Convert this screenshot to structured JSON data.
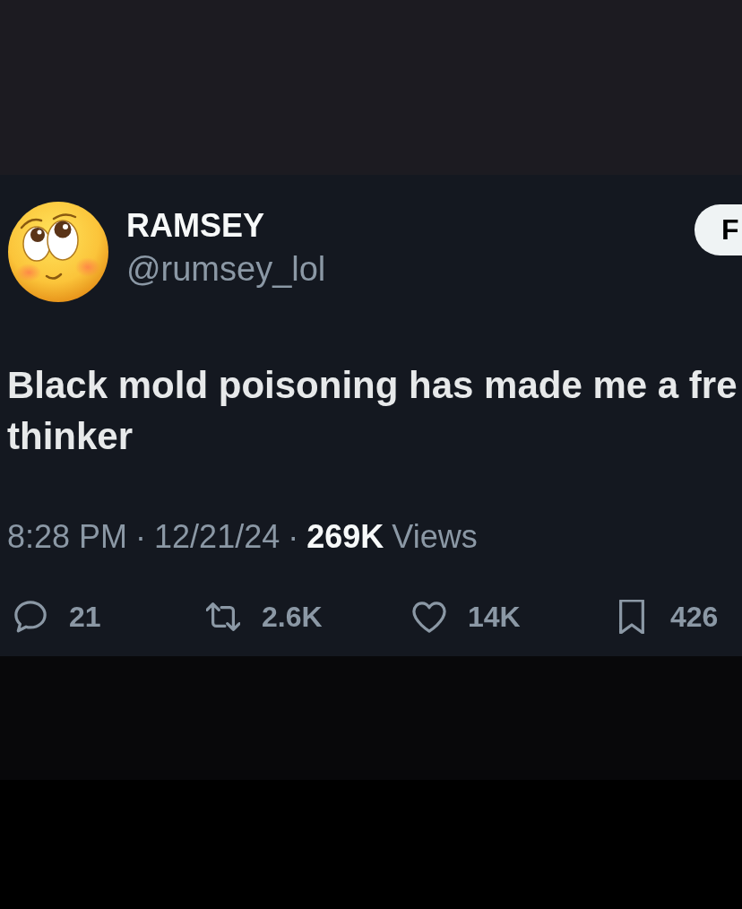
{
  "post": {
    "author": {
      "name": "RAMSEY",
      "handle": "@rumsey_lol"
    },
    "follow_button": {
      "label": "F"
    },
    "text_lines": [
      "Black mold poisoning has made me a fre",
      "thinker"
    ],
    "meta": [
      {
        "kind": "time",
        "text": "8:28 PM"
      },
      {
        "kind": "separator",
        "text": "·"
      },
      {
        "kind": "date",
        "text": "12/21/24"
      },
      {
        "kind": "separator",
        "text": "·"
      },
      {
        "kind": "views_count",
        "text": "269K"
      },
      {
        "kind": "views_label",
        "text": "Views"
      }
    ],
    "actions": [
      {
        "kind": "reply",
        "count": "21"
      },
      {
        "kind": "repost",
        "count": "2.6K"
      },
      {
        "kind": "like",
        "count": "14K"
      },
      {
        "kind": "bookmark",
        "count": "426"
      }
    ]
  }
}
